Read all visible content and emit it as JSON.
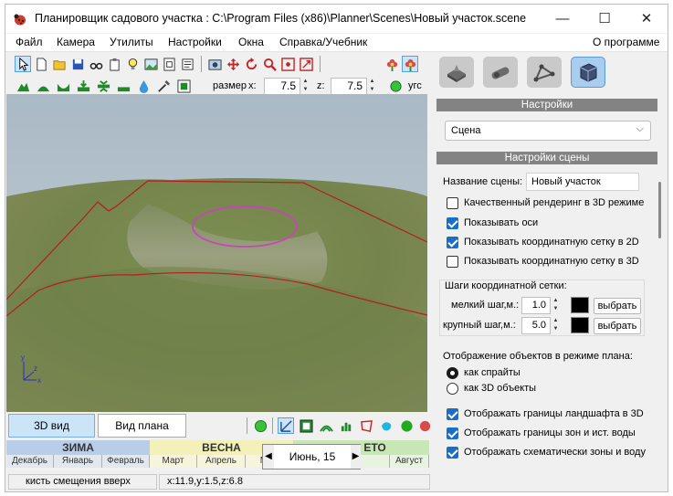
{
  "window": {
    "title": "Планировщик садового участка : C:\\Program Files (x86)\\Planner\\Scenes\\Новый участок.scene",
    "controls": {
      "minimize": "—",
      "maximize": "☐",
      "close": "✕"
    }
  },
  "menu": {
    "items": [
      "Файл",
      "Камера",
      "Утилиты",
      "Настройки",
      "Окна",
      "Справка/Учебник"
    ],
    "about": "О программе"
  },
  "toolbar2": {
    "size_label": "размер",
    "x_label": "x:",
    "x_value": "7.5",
    "z_label": "z:",
    "z_value": "7.5",
    "angle_label": "угс"
  },
  "viewport": {
    "axes": {
      "y": "y",
      "x": "x",
      "z": "z"
    }
  },
  "view_tabs": {
    "active": "3D вид",
    "other": "Вид плана"
  },
  "calendar": {
    "seasons": [
      "ЗИМА",
      "ВЕСНА",
      "ЕТО"
    ],
    "months": [
      "Декабрь",
      "Январь",
      "Февраль",
      "Март",
      "Апрель",
      "Май",
      "оль",
      "Август"
    ],
    "current": "Июнь, 15",
    "prev": "◀",
    "next": "▶"
  },
  "status": {
    "hint": "кисть смещения вверх",
    "coords": "x:11.9,y:1.5,z:6.8"
  },
  "settings": {
    "header": "Настройки",
    "dropdown_value": "Сцена",
    "scene_header": "Настройки сцены",
    "scene_name_label": "Название сцены:",
    "scene_name_value": "Новый участок",
    "checks": [
      {
        "label": "Качественный рендеринг в 3D режиме",
        "checked": false
      },
      {
        "label": "Показывать оси",
        "checked": true
      },
      {
        "label": "Показывать координатную сетку в 2D",
        "checked": true
      },
      {
        "label": "Показывать координатную сетку в 3D",
        "checked": false
      }
    ],
    "grid_group_label": "Шаги координатной сетки:",
    "small_step_label": "мелкий шаг,м.:",
    "small_step_value": "1.0",
    "large_step_label": "крупный шаг,м.:",
    "large_step_value": "5.0",
    "choose_label": "выбрать",
    "plan_mode_label": "Отображение объектов в режиме плана:",
    "radio_sprites": "как спрайты",
    "radio_3d": "как 3D объекты",
    "checks2": [
      {
        "label": "Отображать границы ландшафта в 3D",
        "checked": true
      },
      {
        "label": "Отображать границы зон и ист. воды",
        "checked": true
      },
      {
        "label": "Отображать схематически зоны и воду",
        "checked": true
      }
    ]
  },
  "colors": {
    "winter": "#b8cde8",
    "spring": "#f3f0b8",
    "summer": "#c7e8b5",
    "boundary": "#b31e1e",
    "zone": "#c845b8"
  }
}
